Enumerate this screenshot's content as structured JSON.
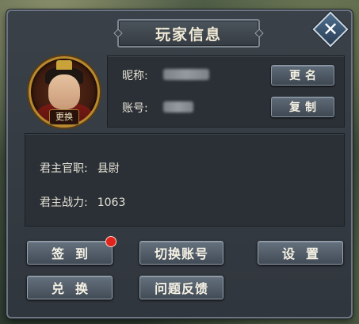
{
  "dialog": {
    "title": "玩家信息",
    "close_icon": "close-icon"
  },
  "avatar": {
    "change_label": "更换"
  },
  "profile": {
    "nickname_label": "昵称:",
    "account_label": "账号:",
    "rename_button": "更名",
    "copy_button": "复制"
  },
  "stats": {
    "rank_label": "君主官职:",
    "rank_value": "县尉",
    "power_label": "君主战力:",
    "power_value": "1063"
  },
  "actions": {
    "checkin": "签到",
    "switch_account": "切换账号",
    "settings": "设置",
    "redeem": "兑换",
    "feedback": "问题反馈"
  },
  "colors": {
    "notification_dot": "#e0241c",
    "avatar_frame": "#b8892f"
  }
}
